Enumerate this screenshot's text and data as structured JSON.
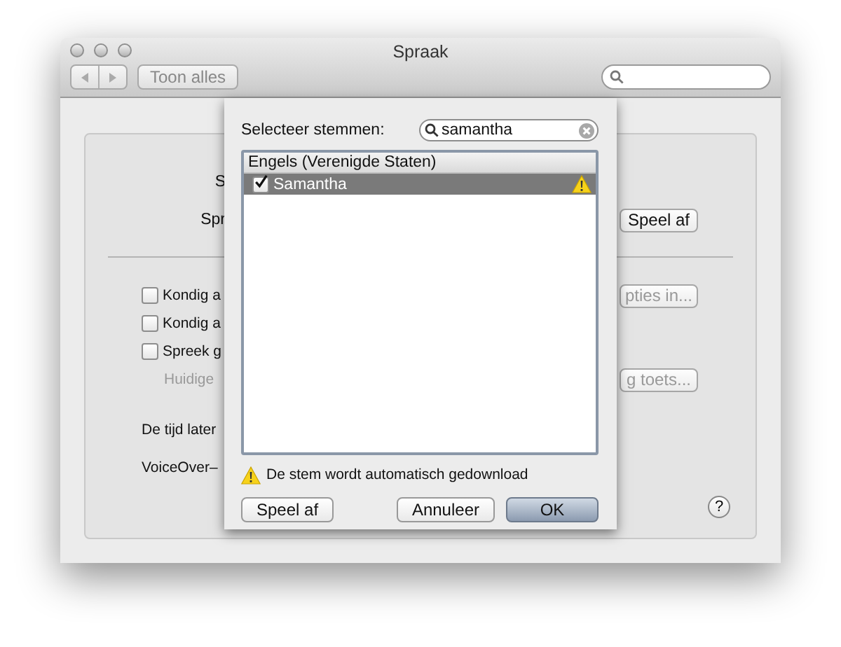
{
  "window": {
    "title": "Spraak"
  },
  "toolbar": {
    "show_all": "Toon alles"
  },
  "panel": {
    "rows": [
      {
        "kind": "label",
        "label": "S"
      },
      {
        "kind": "label",
        "label": "Spr",
        "button": {
          "label": "Speel af",
          "disabled": false
        }
      },
      {
        "kind": "divider"
      },
      {
        "kind": "checkbox",
        "label": "Kondig a",
        "checked": false,
        "button": {
          "label": "pties in...",
          "disabled": true
        }
      },
      {
        "kind": "checkbox",
        "label": "Kondig a",
        "checked": false
      },
      {
        "kind": "checkbox",
        "label": "Spreek g",
        "checked": false
      },
      {
        "kind": "note",
        "label": "Huidige",
        "disabled": true,
        "button": {
          "label": "g toets...",
          "disabled": true
        }
      },
      {
        "kind": "label",
        "label": "De tijd later"
      },
      {
        "kind": "label",
        "label": "VoiceOver–"
      }
    ],
    "help": "?"
  },
  "sheet": {
    "label": "Selecteer stemmen:",
    "search": {
      "value": "samantha"
    },
    "groups": [
      {
        "name": "Engels (Verenigde Staten)",
        "items": [
          {
            "name": "Samantha",
            "checked": true,
            "selected": true,
            "warning": true
          }
        ]
      }
    ],
    "note": "De stem wordt automatisch gedownload",
    "buttons": [
      {
        "label": "Speel af",
        "default": false
      },
      {
        "label": "Annuleer",
        "default": false
      },
      {
        "label": "OK",
        "default": true
      }
    ]
  }
}
